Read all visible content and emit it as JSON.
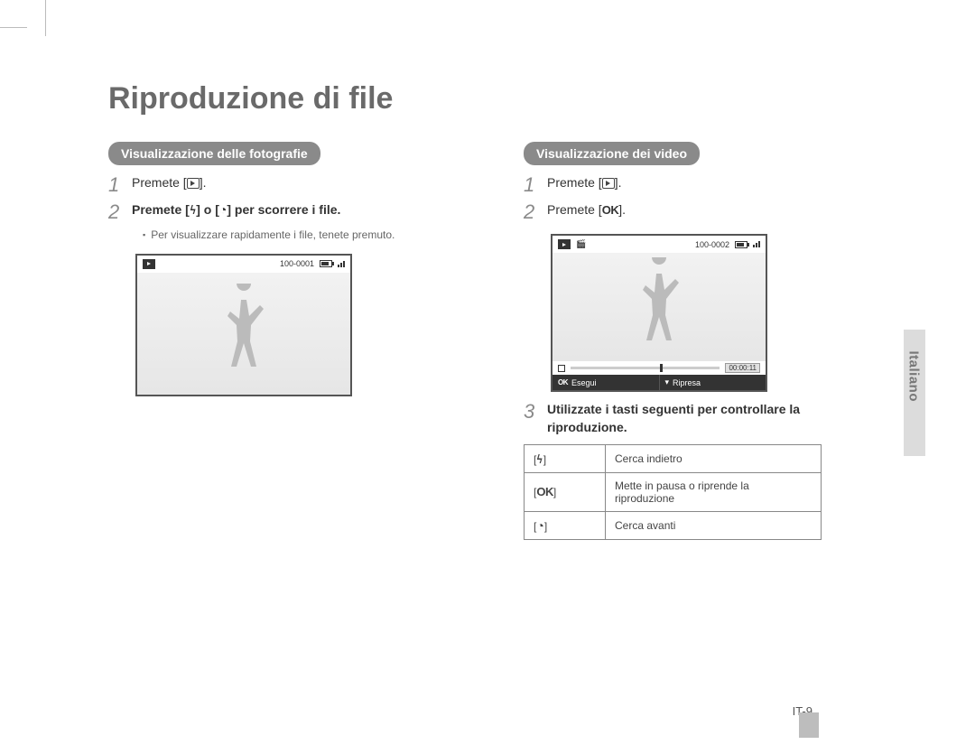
{
  "page": {
    "title": "Riproduzione di file",
    "side_label": "Italiano",
    "page_number": "IT-9"
  },
  "left": {
    "pill": "Visualizzazione delle fotografie",
    "step1": "Premete [",
    "step1_end": "].",
    "step2_a": "Premete [",
    "step2_b": "] o [",
    "step2_c": "] per scorrere i file.",
    "sub": "Per visualizzare rapidamente i file, tenete premuto.",
    "screen": {
      "counter": "100-0001"
    }
  },
  "right": {
    "pill": "Visualizzazione dei video",
    "step1": "Premete [",
    "step1_end": "].",
    "step2": "Premete [",
    "step2_end": "].",
    "step3": "Utilizzate i tasti seguenti per controllare la riproduzione.",
    "screen": {
      "counter": "100-0002",
      "time": "00:00:11",
      "footer_left": "Esegui",
      "footer_right": "Ripresa"
    },
    "table": {
      "r1": "Cerca indietro",
      "r2": "Mette in pausa o riprende la riproduzione",
      "r3": "Cerca avanti"
    }
  }
}
